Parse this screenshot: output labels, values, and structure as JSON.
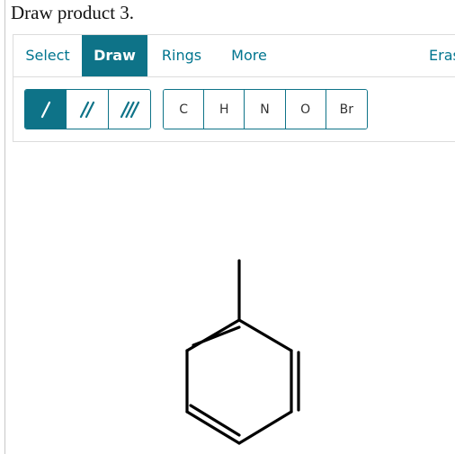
{
  "question": {
    "text": "Draw product 3."
  },
  "tabs": {
    "select": "Select",
    "draw": "Draw",
    "rings": "Rings",
    "more": "More",
    "erase": "Eras"
  },
  "bond_tools": {
    "single_icon": "single-bond-icon",
    "double_icon": "double-bond-icon",
    "triple_icon": "triple-bond-icon",
    "active": "single"
  },
  "atom_tools": [
    "C",
    "H",
    "N",
    "O",
    "Br"
  ],
  "colors": {
    "accent": "#0e7388",
    "tab_text": "#00758f",
    "bond_stroke": "#000000"
  },
  "molecule": {
    "structure": "methylcyclohexadiene"
  }
}
